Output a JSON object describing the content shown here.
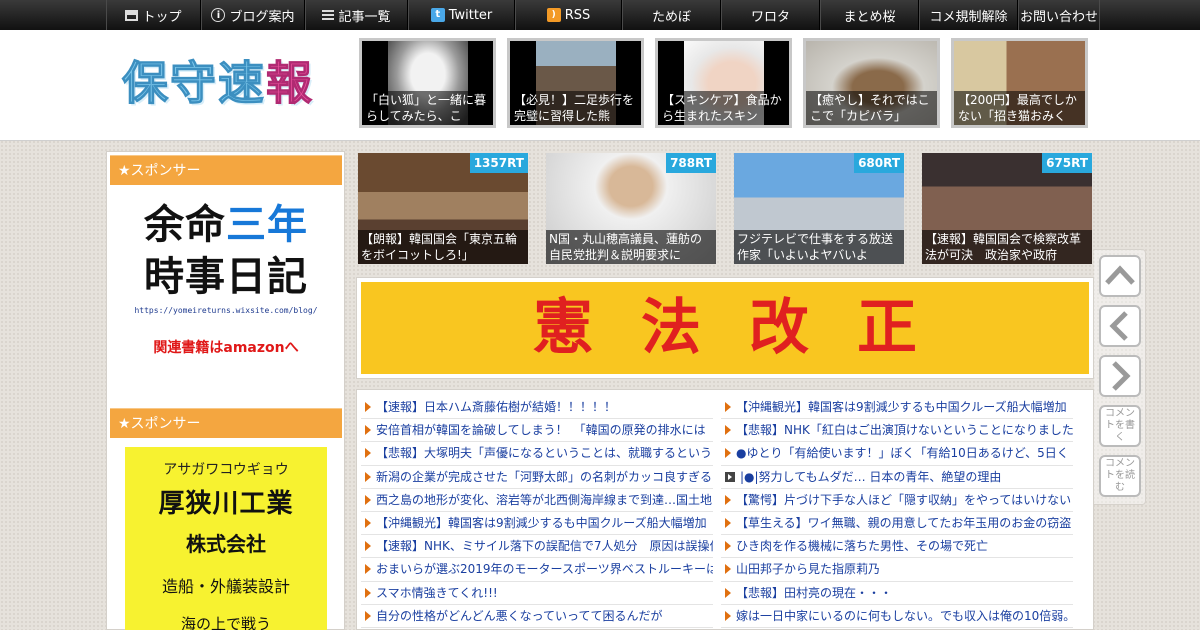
{
  "nav": [
    {
      "label": "トップ",
      "icon": "home-icon"
    },
    {
      "label": "ブログ案内",
      "icon": "info-icon"
    },
    {
      "label": "記事一覧",
      "icon": "list-icon"
    },
    {
      "label": "Twitter",
      "icon": "twitter-icon"
    },
    {
      "label": "RSS",
      "icon": "rss-icon"
    },
    {
      "label": "ためぼ"
    },
    {
      "label": "ワロタ"
    },
    {
      "label": "まとめ桜"
    },
    {
      "label": "コメ規制解除"
    },
    {
      "label": "お問い合わせ"
    }
  ],
  "site": {
    "logo_main": "保守速",
    "logo_last": "報"
  },
  "header_thumbs": [
    {
      "caption": "「白い狐」と一緒に暮らしてみたら、こ"
    },
    {
      "caption": "【必見！】二足歩行を完璧に習得した熊"
    },
    {
      "caption": "【スキンケア】食品から生まれたスキン"
    },
    {
      "caption": "【癒やし】それではここで「カピバラ」"
    },
    {
      "caption": "【200円】最高でしかない「招き猫おみく"
    }
  ],
  "sidebar": {
    "sponsor_label_1": "★スポンサー",
    "ad1_line1a": "余命",
    "ad1_line1b": "三年",
    "ad1_line2": "時事日記",
    "ad1_url": "https://yomeireturns.wixsite.com/blog/",
    "ad1_amazon": "関連書籍はamazonへ",
    "sponsor_label_2": "★スポンサー",
    "ad2_kana": "アサガワコウギョウ",
    "ad2_name": "厚狭川工業",
    "ad2_corp": "株式会社",
    "ad2_desc": "造船・外艤装設計",
    "ad2_more": "海の上で戦う"
  },
  "rt_items": [
    {
      "rt": "1357RT",
      "caption": "【朗報】韓国国会「東京五輪をボイコットしろ!」"
    },
    {
      "rt": "788RT",
      "caption": "N国・丸山穂高議員、蓮舫の自民党批判＆説明要求に"
    },
    {
      "rt": "680RT",
      "caption": "フジテレビで仕事をする放送作家「いよいよヤバいよ"
    },
    {
      "rt": "675RT",
      "caption": "【速報】韓国国会で検察改革法が可決　政治家や政府"
    }
  ],
  "banner": {
    "text": "憲法改正"
  },
  "articles_left": [
    {
      "title": "【速報】日本ハム斎藤佑樹が結婚！！！！！"
    },
    {
      "title": "安倍首相が韓国を論破してしまう！　「韓国の原発の排水には"
    },
    {
      "title": "【悲報】大塚明夫「声優になるということは、就職するというこ"
    },
    {
      "title": "新潟の企業が完成させた「河野太郎」の名刺がカッコ良すぎる"
    },
    {
      "title": "西之島の地形が変化、溶岩等が北西側海岸線まで到達…国土地"
    },
    {
      "title": "【沖縄観光】韓国客は9割減少するも中国クルーズ船大幅増加"
    },
    {
      "title": "【速報】NHK、ミサイル落下の誤配信で7人処分　原因は誤操作"
    },
    {
      "title": "おまいらが選ぶ2019年のモータースポーツ界ベストルーキーは"
    },
    {
      "title": "スマホ情強きてくれ!!!"
    },
    {
      "title": "自分の性格がどんどん悪くなっていってて困るんだが"
    }
  ],
  "articles_right": [
    {
      "title": "【沖縄観光】韓国客は9割減少するも中国クルーズ船大幅増加",
      "box": false
    },
    {
      "title": "【悲報】NHK「紅白はご出演頂けないということになりました",
      "box": false
    },
    {
      "title": "●ゆとり「有給使います！」ぼく「有給10日あるけど、5日く",
      "box": false
    },
    {
      "title": "|●|努力してもムダだ… 日本の青年、絶望の理由",
      "box": true
    },
    {
      "title": "【驚愕】片づけ下手な人ほど「隠す収納」をやってはいけない",
      "box": false
    },
    {
      "title": "【草生える】ワイ無職、親の用意してたお年玉用のお金の窃盗",
      "box": false
    },
    {
      "title": "ひき肉を作る機械に落ちた男性、その場で死亡",
      "box": false
    },
    {
      "title": "山田邦子から見た指原莉乃",
      "box": false
    },
    {
      "title": "【悲報】田村亮の現在・・・",
      "box": false
    },
    {
      "title": "嫁は一日中家にいるのに何もしない。でも収入は俺の10倍弱。",
      "box": false
    }
  ],
  "float_buttons": {
    "write_comment": "コメントを書く",
    "read_comment": "コメントを読む"
  }
}
